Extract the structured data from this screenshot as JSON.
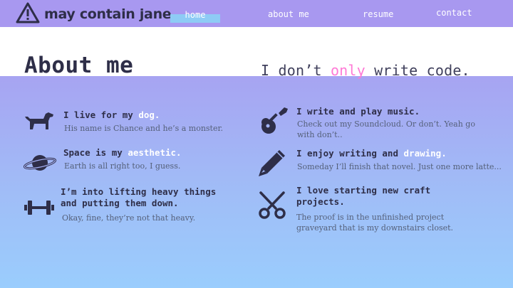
{
  "nav": {
    "logo_text": "may contain jane",
    "items": [
      {
        "label": "home",
        "active": true
      },
      {
        "label": "about me"
      },
      {
        "label": "resume"
      },
      {
        "label": "contact"
      }
    ]
  },
  "header": {
    "title": "About me",
    "tagline_pre": "I don’t ",
    "tagline_accent": "only",
    "tagline_post": " write code."
  },
  "items": [
    {
      "icon": "dog-icon",
      "title_pre": "I live for my ",
      "title_hl": "dog.",
      "desc": "His name is Chance and he’s a monster."
    },
    {
      "icon": "planet-icon",
      "title_pre": "Space is my ",
      "title_hl": "aesthetic.",
      "desc": "Earth is all right too, I guess."
    },
    {
      "icon": "dumbbell-icon",
      "title_line1": "I’m into lifting heavy things",
      "title_line2": "and putting them down.",
      "desc": "Okay, fine, they’re not that heavy."
    },
    {
      "icon": "guitar-icon",
      "title": "I write and play music.",
      "desc_line1": "Check out my Soundcloud. Or don’t. Yeah go",
      "desc_line2": "with don’t.."
    },
    {
      "icon": "pencil-icon",
      "title_pre": "I enjoy writing and ",
      "title_hl": "drawing.",
      "desc": "Someday I’ll finish that novel. Just one more latte..."
    },
    {
      "icon": "scissors-icon",
      "title_line1": "I love starting new craft",
      "title_line2": "projects.",
      "desc_line1": "The proof is in the unfinished project",
      "desc_line2": "graveyard that is my downstairs closet."
    }
  ],
  "colors": {
    "nav_bg": "#a898f0",
    "accent_pink": "#ff7ad6",
    "dark": "#2e2e48",
    "gradient_top": "#a7a4f2",
    "gradient_bottom": "#9acdfd"
  }
}
